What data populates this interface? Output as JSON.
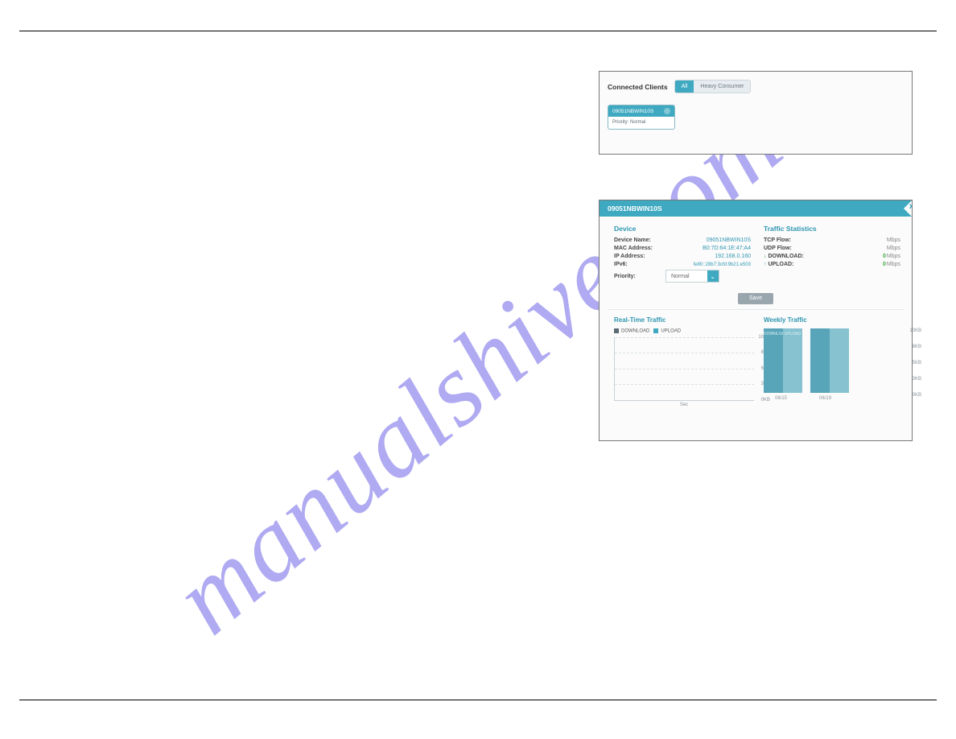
{
  "watermark": "manualshive.com",
  "connected_clients": {
    "title": "Connected Clients",
    "tabs": {
      "all": "All",
      "heavy": "Heavy Consumer"
    },
    "card": {
      "name": "09051NBWIN10S",
      "priority_label": "Priority: Normal"
    }
  },
  "device_panel": {
    "banner_name": "09051NBWIN10S",
    "section_device": "Device",
    "section_traffic": "Traffic Statistics",
    "rows": {
      "device_name": {
        "label": "Device Name:",
        "value": "09051NBWIN10S"
      },
      "mac": {
        "label": "MAC Address:",
        "value": "B0:7D:64:1E:47:A4"
      },
      "ip": {
        "label": "IP Address:",
        "value": "192.168.0.160"
      },
      "ipv6": {
        "label": "IPv6:",
        "value": "fe80::28b7:3cfd:9b21:e503"
      },
      "priority": {
        "label": "Priority:",
        "value": "Normal"
      }
    },
    "traffic_rows": {
      "tcp": {
        "label": "TCP Flow:",
        "value": "",
        "unit": "Mbps"
      },
      "udp": {
        "label": "UDP Flow:",
        "value": "",
        "unit": "Mbps"
      },
      "download": {
        "label": "DOWNLOAD:",
        "value": "0",
        "unit": "Mbps"
      },
      "upload": {
        "label": "UPLOAD:",
        "value": "0",
        "unit": "Mbps"
      }
    },
    "save": "Save",
    "realtime_title": "Real-Time Traffic",
    "realtime_legend": {
      "download": "DOWNLOAD",
      "upload": "UPLOAD"
    },
    "realtime_xlabel": "Sec",
    "weekly_title": "Weekly Traffic",
    "weekly_legend": {
      "download": "DOWNLOAD",
      "upload": "UPLOAD"
    },
    "weekly_x": [
      "06/15",
      "06/19"
    ]
  },
  "chart_data": [
    {
      "type": "line",
      "name": "real_time_traffic",
      "series": [
        {
          "name": "DOWNLOAD",
          "values": [
            0,
            0,
            0,
            0,
            0,
            0
          ]
        },
        {
          "name": "UPLOAD",
          "values": [
            0,
            0,
            0,
            0,
            0,
            0
          ]
        }
      ],
      "y_ticks": [
        "10KB",
        "8KB",
        "6KB",
        "3KB",
        "0KB"
      ],
      "ylim": [
        0,
        10
      ],
      "xlabel": "Sec",
      "ylabel": ""
    },
    {
      "type": "bar",
      "name": "weekly_traffic",
      "categories": [
        "06/15",
        "06/19"
      ],
      "series": [
        {
          "name": "DOWNLOAD",
          "values": [
            10,
            10
          ]
        },
        {
          "name": "UPLOAD",
          "values": [
            10,
            10
          ]
        }
      ],
      "y_ticks": [
        "10KB",
        "8KB",
        "5KB",
        "3KB",
        "0KB"
      ],
      "ylim": [
        0,
        10
      ],
      "unit": "KB"
    }
  ]
}
